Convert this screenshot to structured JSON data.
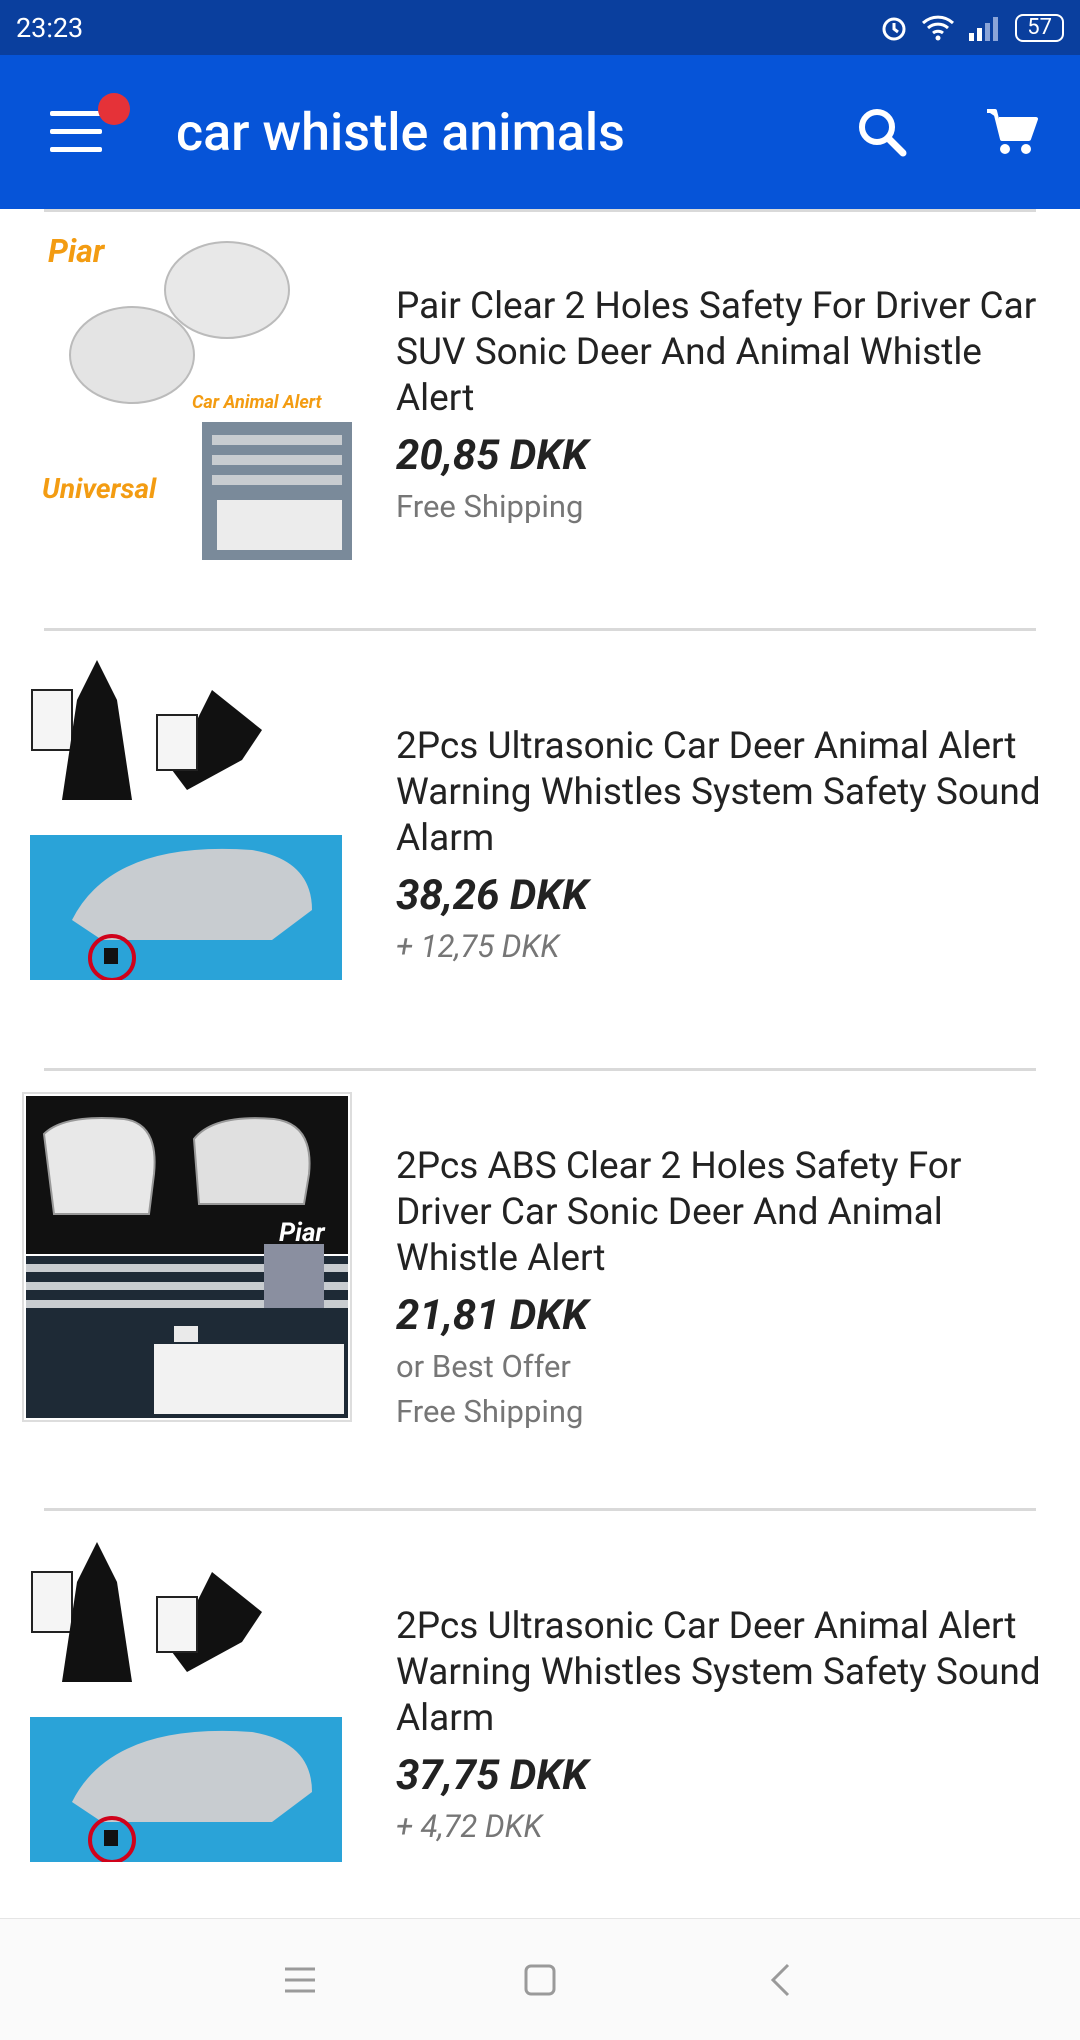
{
  "status": {
    "time": "23:23",
    "battery": "57"
  },
  "app_bar": {
    "title": "car whistle animals"
  },
  "listings": [
    {
      "title": "Pair Clear 2 Holes Safety For Driver Car SUV Sonic Deer And Animal Whistle Alert",
      "price": "20,85 DKK",
      "line1": "Free Shipping",
      "line2": "",
      "thumb_labels": {
        "top": "Piar",
        "mid": "Car Animal Alert",
        "bottom": "Universal"
      }
    },
    {
      "title": "2Pcs Ultrasonic Car Deer Animal Alert Warning Whistles System Safety Sound Alarm",
      "price": "38,26 DKK",
      "line1": "+ 12,75 DKK",
      "line2": ""
    },
    {
      "title": "2Pcs ABS Clear 2 Holes Safety For Driver Car Sonic Deer And Animal Whistle Alert",
      "price": "21,81 DKK",
      "line1": "or Best Offer",
      "line2": "Free Shipping",
      "thumb_labels": {
        "top": "Piar"
      }
    },
    {
      "title": "2Pcs Ultrasonic Car Deer Animal Alert Warning Whistles System Safety Sound Alarm",
      "price": "37,75 DKK",
      "line1": "+ 4,72 DKK",
      "line2": ""
    }
  ],
  "icons": {
    "menu": "hamburger-menu-icon",
    "search": "search-icon",
    "cart": "cart-icon",
    "notification": "notification-dot-icon"
  },
  "colors": {
    "status_bar": "#0a3f9e",
    "app_bar": "#0654d8",
    "badge": "#e53238",
    "label_orange": "#f39c12"
  }
}
